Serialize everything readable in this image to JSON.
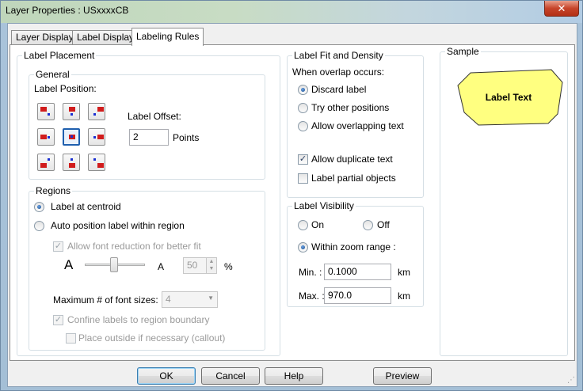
{
  "window": {
    "title": "Layer Properties  : USxxxxCB",
    "close_symbol": "✕"
  },
  "tabs": [
    {
      "label": "Layer Display",
      "active": false
    },
    {
      "label": "Label Display",
      "active": false
    },
    {
      "label": "Labeling Rules",
      "active": true
    }
  ],
  "label_placement": {
    "legend": "Label Placement",
    "general": {
      "legend": "General",
      "position_label": "Label Position:",
      "offset_label": "Label Offset:",
      "offset_value": "2",
      "offset_units": "Points",
      "selected_position": "center"
    },
    "regions": {
      "legend": "Regions",
      "centroid_label": "Label at centroid",
      "auto_position_label": "Auto position label within region",
      "font_reduction_label": "Allow font reduction for better fit",
      "font_large_glyph": "A",
      "font_small_glyph": "A",
      "reduction_value": "50",
      "reduction_unit": "%",
      "max_font_sizes_label": "Maximum # of font sizes:",
      "max_font_sizes_value": "4",
      "confine_label": "Confine labels to region boundary",
      "callout_label": "Place outside if necessary (callout)"
    }
  },
  "fit_density": {
    "legend": "Label Fit and Density",
    "overlap_heading": "When overlap occurs:",
    "discard_label": "Discard label",
    "try_other_label": "Try other positions",
    "allow_overlap_label": "Allow overlapping text",
    "allow_duplicate_label": "Allow duplicate text",
    "partial_objects_label": "Label partial objects",
    "overlap_choice": "discard",
    "allow_duplicate_checked": true,
    "partial_objects_checked": false
  },
  "visibility": {
    "legend": "Label Visibility",
    "on_label": "On",
    "off_label": "Off",
    "zoom_range_label": "Within zoom range :",
    "min_label": "Min. :",
    "min_value": "0.1000",
    "max_label": "Max. :",
    "max_value": "970.0",
    "units": "km",
    "choice": "zoom"
  },
  "sample": {
    "legend": "Sample",
    "text": "Label Text",
    "fill_color": "#ffff80"
  },
  "buttons": {
    "ok": "OK",
    "cancel": "Cancel",
    "help": "Help",
    "preview": "Preview"
  },
  "colors": {
    "marker_red": "#d11c1c",
    "marker_blue": "#1a2fd2",
    "selection_blue": "#1f5fae"
  }
}
